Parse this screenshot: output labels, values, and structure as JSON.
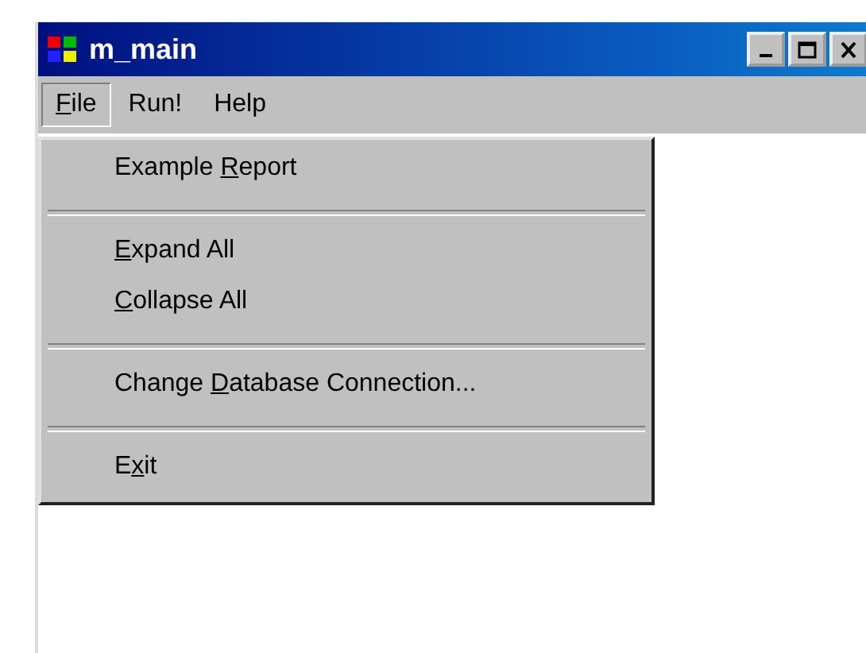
{
  "window": {
    "title": "m_main"
  },
  "menu_bar": [
    {
      "access_key": "F",
      "text_after": "ile",
      "selected": true
    },
    {
      "text_before": "Run!",
      "selected": false
    },
    {
      "text_before": "Help",
      "selected": false
    }
  ],
  "file_menu": [
    {
      "kind": "item",
      "text_before": "Example ",
      "access_key": "R",
      "text_after": "eport"
    },
    {
      "kind": "separator"
    },
    {
      "kind": "item",
      "access_key": "E",
      "text_after": "xpand All"
    },
    {
      "kind": "item",
      "access_key": "C",
      "text_after": "ollapse All"
    },
    {
      "kind": "separator"
    },
    {
      "kind": "item",
      "text_before": "Change ",
      "access_key": "D",
      "text_after": "atabase Connection..."
    },
    {
      "kind": "separator"
    },
    {
      "kind": "item",
      "text_before": "E",
      "access_key": "x",
      "text_after": "it"
    }
  ]
}
